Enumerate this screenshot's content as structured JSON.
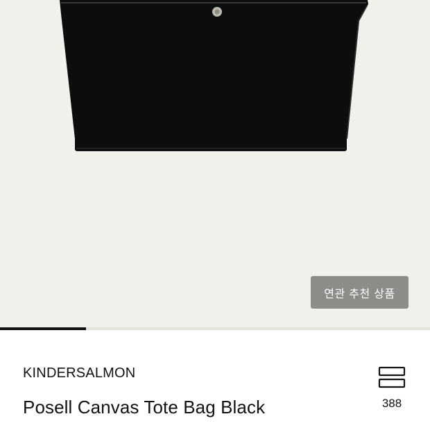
{
  "colors": {
    "hero_background": "#f2f0eb",
    "bag_color": "#0d0d0d",
    "button_background": "#8e8c89",
    "button_text": "#ffffff",
    "progress_fill": "#111111",
    "text": "#111111"
  },
  "gallery": {
    "related_button_label": "연관 추천 상품",
    "progress": 0.2
  },
  "product": {
    "brand": "KINDERSALMON",
    "name": "Posell Canvas Tote Bag Black"
  },
  "save": {
    "icon": "stack-icon",
    "count": "388"
  }
}
